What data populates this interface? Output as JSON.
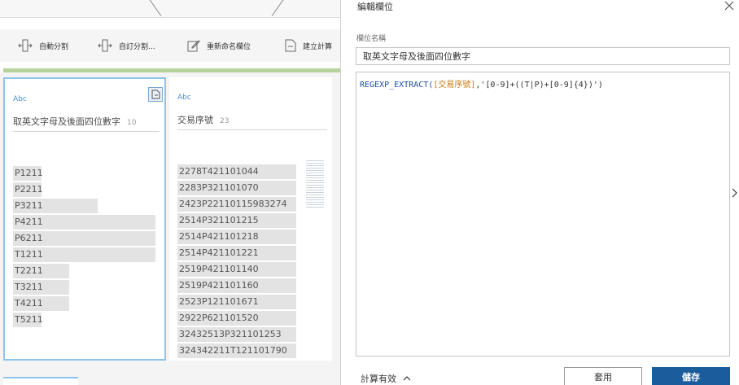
{
  "toolbar": {
    "auto_split": "自動分割",
    "custom_split": "自訂分割...",
    "rename_field": "重新命名欄位",
    "create_calc": "建立計算"
  },
  "columns": [
    {
      "type": "Abc",
      "name": "取英文字母及後面四位數字",
      "count": "10",
      "values": [
        "P1211",
        "P2211",
        "P3211",
        "P4211",
        "P6211",
        "T1211",
        "T2211",
        "T3211",
        "T4211",
        "T5211"
      ],
      "bar_fractions": [
        0.19,
        0.19,
        0.57,
        0.96,
        0.96,
        0.96,
        0.38,
        0.38,
        0.38,
        0.19
      ]
    },
    {
      "type": "Abc",
      "name": "交易序號",
      "count": "23",
      "values": [
        "2278T421101044",
        "2283P321101070",
        "2423P22110115983274",
        "2514P321101215",
        "2514P421101218",
        "2514P421101221",
        "2519P421101140",
        "2519P421101160",
        "2523P121101671",
        "2922P621101520",
        "32432513P321101253",
        "324342211T121101790"
      ],
      "bar_fractions": [
        1,
        1,
        1,
        1,
        1,
        1,
        1,
        1,
        1,
        1,
        1,
        1
      ]
    }
  ],
  "panel": {
    "title": "編輯欄位",
    "field_label": "欄位名稱",
    "field_value": "取英文字母及後面四位數字",
    "formula": {
      "fn": "REGEXP_EXTRACT(",
      "ref": "[交易序號]",
      "rest": ",'[0-9]+((T|P)+[0-9]{4})')"
    },
    "status": "計算有效",
    "apply": "套用",
    "save": "儲存"
  },
  "colors": {
    "accent_blue": "#1b5d9c",
    "selection_border": "#8ec3ea",
    "progress_green": "#b7d29d",
    "function_color": "#1f4fa8",
    "reference_color": "#c87d10"
  }
}
